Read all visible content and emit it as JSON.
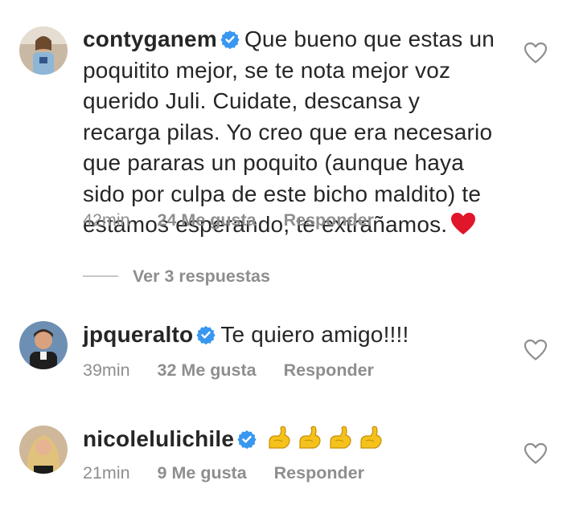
{
  "comments": [
    {
      "username": "contyganem",
      "text_lines": [
        "Que bueno que estas un",
        "poquitito mejor, se te nota mejor voz",
        "querido Juli. Cuidate, descansa y",
        "recarga pilas. Yo creo que era necesario",
        "que pararas un poquito (aunque haya",
        "sido por culpa de este bicho maldito) te",
        "estamos esperando, te extrañamos."
      ],
      "time": "42min",
      "likes": "24 Me gusta",
      "reply": "Responder",
      "view_replies": "Ver 3 respuestas"
    },
    {
      "username": "jpqueralto",
      "text": "Te quiero amigo!!!!",
      "time": "39min",
      "likes": "32 Me gusta",
      "reply": "Responder"
    },
    {
      "username": "nicolelulichile",
      "time": "21min",
      "likes": "9 Me gusta",
      "reply": "Responder"
    }
  ],
  "icons": {
    "verified": "verified-badge-icon",
    "like": "heart-outline-icon",
    "emoji_heart": "red-heart-emoji",
    "emoji_flex": "flexed-biceps-emoji"
  },
  "colors": {
    "text": "#262626",
    "secondary": "#8e8e8e",
    "verified": "#3897f0",
    "emoji_heart": "#e0162b",
    "emoji_flex": "#f4c21b"
  }
}
